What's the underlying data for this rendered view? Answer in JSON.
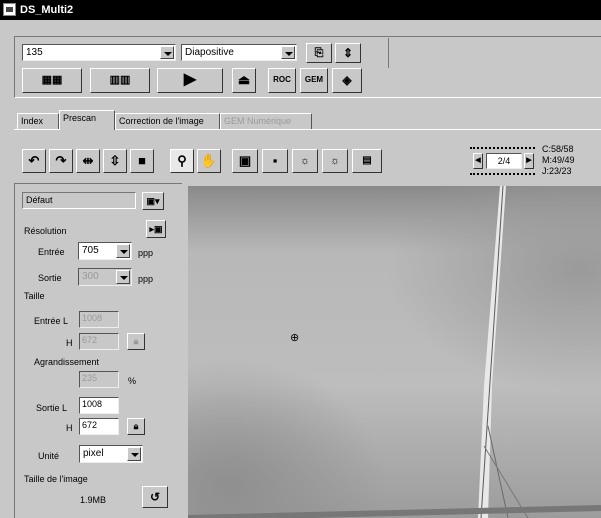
{
  "app": {
    "title": "DS_Multi2"
  },
  "film": {
    "size": "135",
    "type": "Diapositive"
  },
  "tabs": [
    "Index",
    "Prescan",
    "Correction de l'image",
    "GEM Numérique"
  ],
  "toolbar_icons": [
    "rotate-left-icon",
    "rotate-right-icon",
    "flip-horizontal-icon",
    "flip-vertical-icon",
    "crop-icon",
    "zoom-icon",
    "hand-icon",
    "autofocus-icon",
    "manual-focus-icon",
    "ae-icon",
    "manual-ae-icon",
    "white-balance-icon"
  ],
  "frame_counter": {
    "value": "2/4",
    "c": "C:58/58",
    "m": "M:49/49",
    "j": "J:23/23"
  },
  "left_panel": {
    "preset": "Défaut",
    "resolution_label": "Résolution",
    "input_label": "Entrée",
    "input_value": "705",
    "ppp": "ppp",
    "output_label": "Sortie",
    "output_value": "300",
    "ppp2": "ppp",
    "size_label": "Taille",
    "input_l_label": "Entrée L",
    "input_l_value": "1008",
    "input_h_label": "H",
    "input_h_value": "672",
    "magnification_label": "Agrandissement",
    "magnification_value": "235",
    "percent": "%",
    "output_l_label": "Sortie L",
    "output_l_value": "1008",
    "output_h_label": "H",
    "output_h_value": "672",
    "unit_label": "Unité",
    "unit_value": "pixel",
    "image_size_label": "Taille de l'image",
    "image_size_value": "1.9MB"
  }
}
